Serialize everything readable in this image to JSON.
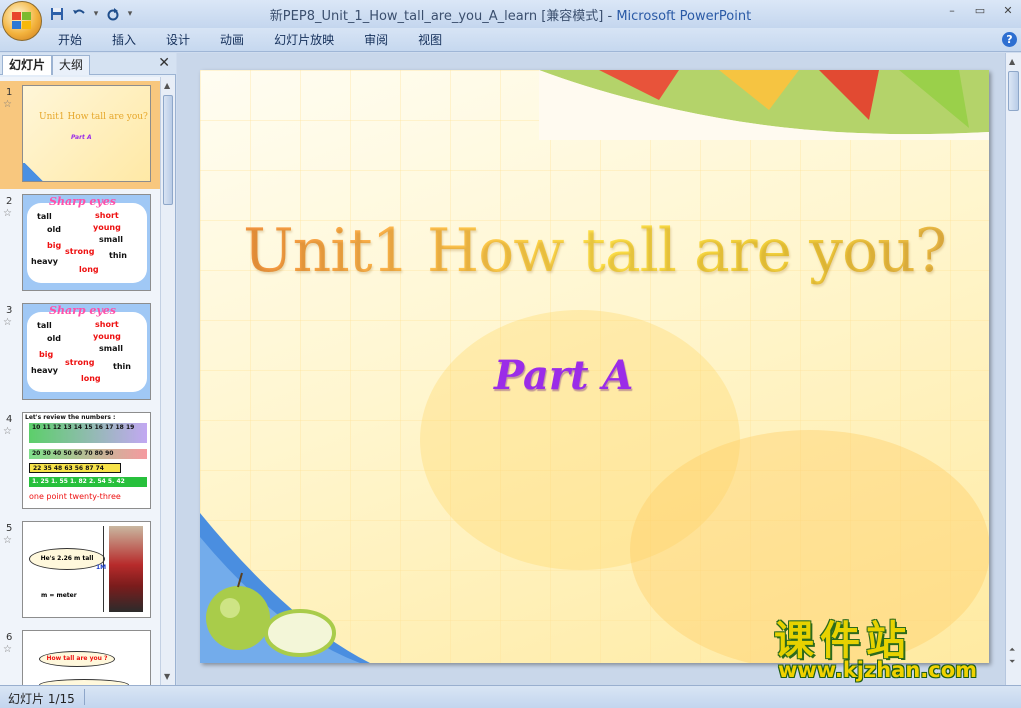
{
  "window": {
    "title_doc": "新PEP8_Unit_1_How_tall_are_you_A_learn [兼容模式]",
    "title_sep": " - ",
    "title_app": "Microsoft PowerPoint",
    "controls": [
      "–",
      "▭",
      "✕"
    ]
  },
  "ribbon": {
    "tabs": [
      "开始",
      "插入",
      "设计",
      "动画",
      "幻灯片放映",
      "审阅",
      "视图"
    ],
    "help": "?"
  },
  "quick_access": {
    "save_icon": "save-icon",
    "undo_icon": "undo-icon",
    "redo_icon": "redo-icon",
    "customize_icon": "dropdown-icon"
  },
  "pane": {
    "tab_slides": "幻灯片",
    "tab_outline": "大纲",
    "close": "✕"
  },
  "thumbnails": [
    {
      "num": "1",
      "title": "Unit1  How tall are you?",
      "sub": "Part A"
    },
    {
      "num": "2",
      "header": "Sharp eyes",
      "words": [
        {
          "t": "tall",
          "c": "bk"
        },
        {
          "t": "short",
          "c": "rd"
        },
        {
          "t": "old",
          "c": "bk"
        },
        {
          "t": "young",
          "c": "rd"
        },
        {
          "t": "small",
          "c": "bk"
        },
        {
          "t": "big",
          "c": "rd"
        },
        {
          "t": "strong",
          "c": "rd"
        },
        {
          "t": "thin",
          "c": "bk"
        },
        {
          "t": "heavy",
          "c": "bk"
        },
        {
          "t": "long",
          "c": "rd"
        }
      ]
    },
    {
      "num": "3",
      "header": "Sharp eyes",
      "words": [
        {
          "t": "tall",
          "c": "bk"
        },
        {
          "t": "short",
          "c": "rd"
        },
        {
          "t": "old",
          "c": "bk"
        },
        {
          "t": "young",
          "c": "rd"
        },
        {
          "t": "small",
          "c": "bk"
        },
        {
          "t": "big",
          "c": "rd"
        },
        {
          "t": "strong",
          "c": "rd"
        },
        {
          "t": "thin",
          "c": "bk"
        },
        {
          "t": "heavy",
          "c": "bk"
        },
        {
          "t": "long",
          "c": "rd"
        }
      ]
    },
    {
      "num": "4",
      "header": "Let's review  the numbers :",
      "rows": [
        "10 11 12 13 14 15 16 17 18 19",
        "20 30 40 50 60 70 80 90",
        "22 35 48 63 56 87 74",
        "1. 25 1. 55 1. 82 2. 54 5. 42"
      ],
      "footer_red": "one point",
      "footer_plain": "twenty-three"
    },
    {
      "num": "5",
      "bubble": "He's 2.26 m  tall",
      "unit": "1M",
      "note": "m = meter"
    },
    {
      "num": "6",
      "bubble": "How tall are you ?"
    }
  ],
  "slide": {
    "title": "Unit1  How tall are you?",
    "subtitle": "Part A"
  },
  "watermark": {
    "title": "课件站",
    "url": "www.kjzhan.com"
  },
  "status": {
    "slide_counter": "幻灯片 1/15"
  },
  "colors": {
    "title_gradient_start": "#f1893b",
    "title_gradient_end": "#ffe24a",
    "subtitle": "#9b2ce8",
    "selected_thumb": "#f8c77e"
  }
}
